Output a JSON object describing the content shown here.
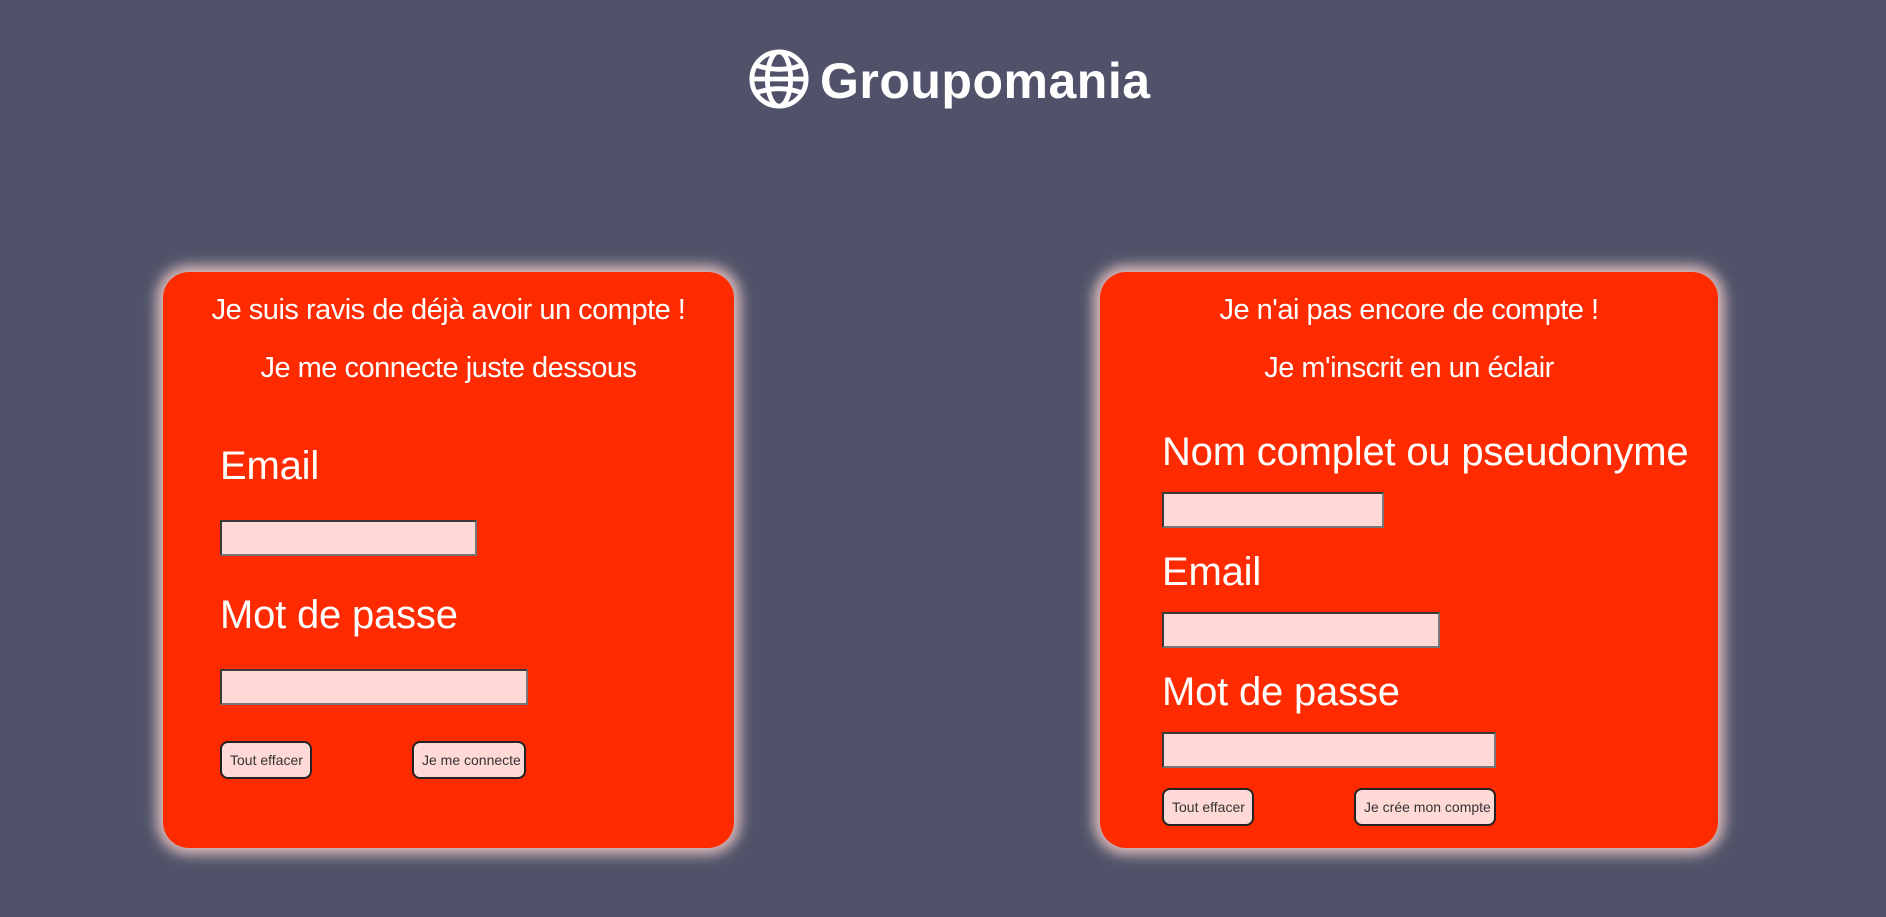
{
  "header": {
    "brand_name": "Groupomania",
    "logo_icon": "globe-icon",
    "brand_color": "#ffffff"
  },
  "colors": {
    "background": "#4f5268",
    "card": "#ff2b00",
    "input": "#ffd9d6"
  },
  "login": {
    "title": "Je suis ravis de déjà avoir un compte !",
    "subtitle": "Je me connecte juste dessous",
    "email_label": "Email",
    "email_value": "",
    "password_label": "Mot de passe",
    "password_value": "",
    "clear_button": "Tout effacer",
    "submit_button": "Je me connecte"
  },
  "signup": {
    "title": "Je n'ai pas encore de compte !",
    "subtitle": "Je m'inscrit en un éclair",
    "name_label": "Nom complet ou pseudonyme",
    "name_value": "",
    "email_label": "Email",
    "email_value": "",
    "password_label": "Mot de passe",
    "password_value": "",
    "clear_button": "Tout effacer",
    "submit_button": "Je crée mon compte"
  }
}
